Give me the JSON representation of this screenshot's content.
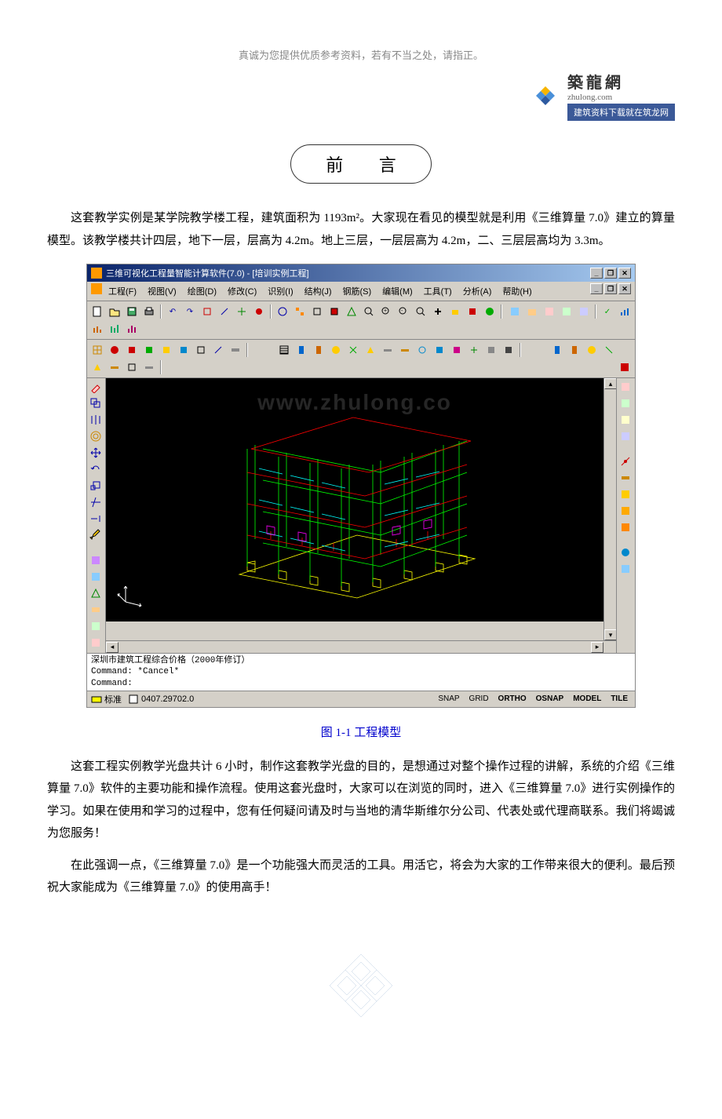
{
  "header": {
    "note": "真诚为您提供优质参考资料，若有不当之处，请指正。"
  },
  "logo": {
    "cn": "築龍網",
    "en": "zhulong.com",
    "banner": "建筑资料下载就在筑龙网"
  },
  "title": "前 言",
  "paragraphs": {
    "p1": "这套教学实例是某学院教学楼工程，建筑面积为 1193m²。大家现在看见的模型就是利用《三维算量 7.0》建立的算量模型。该教学楼共计四层，地下一层，层高为 4.2m。地上三层，一层层高为 4.2m，二、三层层高均为 3.3m。",
    "p2": "这套工程实例教学光盘共计 6 小时，制作这套教学光盘的目的，是想通过对整个操作过程的讲解，系统的介绍《三维算量 7.0》软件的主要功能和操作流程。使用这套光盘时，大家可以在浏览的同时，进入《三维算量 7.0》进行实例操作的学习。如果在使用和学习的过程中，您有任何疑问请及时与当地的清华斯维尔分公司、代表处或代理商联系。我们将竭诚为您服务！",
    "p3": "在此强调一点，《三维算量 7.0》是一个功能强大而灵活的工具。用活它，将会为大家的工作带来很大的便利。最后预祝大家能成为《三维算量 7.0》的使用高手！"
  },
  "app": {
    "title": "三维可视化工程量智能计算软件(7.0) - [培训实例工程]",
    "menus": [
      "工程(F)",
      "视图(V)",
      "绘图(D)",
      "修改(C)",
      "识别(I)",
      "结构(J)",
      "钢筋(S)",
      "编辑(M)",
      "工具(T)",
      "分析(A)",
      "帮助(H)"
    ],
    "watermark": "www.zhulong.co",
    "cmd": {
      "line1": "深圳市建筑工程综合价格（2000年修订）",
      "line2": "Command: *Cancel*",
      "line3": "Command:"
    },
    "status": {
      "layer": "标准",
      "coords": "0407.29702.0",
      "modes": [
        "SNAP",
        "GRID",
        "ORTHO",
        "OSNAP",
        "MODEL",
        "TILE"
      ]
    }
  },
  "caption": "图 1-1  工程模型",
  "icons": {
    "new": "□",
    "open": "📂",
    "save": "💾",
    "print": "🖨",
    "undo": "↶",
    "redo": "↷"
  }
}
